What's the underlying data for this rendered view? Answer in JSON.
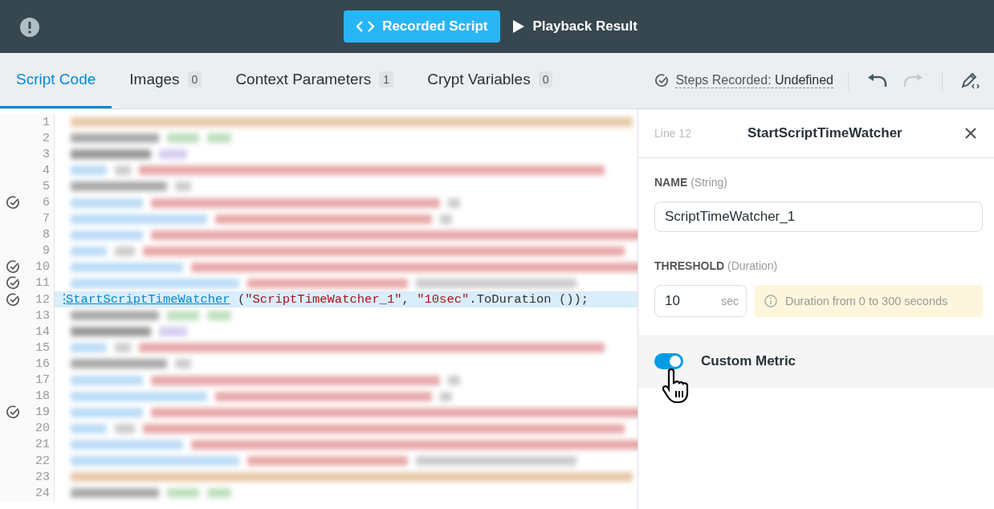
{
  "top_bar": {
    "modes": [
      {
        "label": "Recorded Script",
        "selected": true
      },
      {
        "label": "Playback Result",
        "selected": false
      }
    ]
  },
  "tabs": [
    {
      "label": "Script Code",
      "selected": true
    },
    {
      "label": "Images",
      "count": "0",
      "selected": false
    },
    {
      "label": "Context Parameters",
      "count": "1",
      "selected": false
    },
    {
      "label": "Crypt Variables",
      "count": "0",
      "selected": false
    }
  ],
  "steps_recorded": {
    "label": "Steps Recorded:",
    "value": "Undefined"
  },
  "toolbar": [
    {
      "kind": "undo",
      "disabled": false
    },
    {
      "kind": "redo",
      "disabled": true
    },
    {
      "kind": "edit",
      "disabled": false
    }
  ],
  "editor": {
    "lines": [
      {
        "number": "1",
        "checked": false,
        "selected": false,
        "kind": "blurred"
      },
      {
        "number": "2",
        "checked": false,
        "selected": false,
        "kind": "blurred"
      },
      {
        "number": "3",
        "checked": false,
        "selected": false,
        "kind": "blurred"
      },
      {
        "number": "4",
        "checked": false,
        "selected": false,
        "kind": "blurred"
      },
      {
        "number": "5",
        "checked": false,
        "selected": false,
        "kind": "blurred"
      },
      {
        "number": "6",
        "checked": true,
        "selected": false,
        "kind": "blurred"
      },
      {
        "number": "7",
        "checked": false,
        "selected": false,
        "kind": "blurred"
      },
      {
        "number": "8",
        "checked": false,
        "selected": false,
        "kind": "blurred"
      },
      {
        "number": "9",
        "checked": false,
        "selected": false,
        "kind": "blurred"
      },
      {
        "number": "10",
        "checked": true,
        "selected": false,
        "kind": "blurred"
      },
      {
        "number": "11",
        "checked": true,
        "selected": false,
        "kind": "blurred"
      },
      {
        "number": "12",
        "checked": true,
        "selected": true,
        "kind": "code",
        "marker": "⋮",
        "function": "StartScriptTimeWatcher",
        "open": " (",
        "args": [
          "\"ScriptTimeWatcher_1\"",
          "\"10sec\""
        ],
        "separator": ", ",
        "tail": ".ToDuration ());"
      },
      {
        "number": "13",
        "checked": false,
        "selected": false,
        "kind": "blurred"
      },
      {
        "number": "14",
        "checked": false,
        "selected": false,
        "kind": "blurred"
      },
      {
        "number": "15",
        "checked": false,
        "selected": false,
        "kind": "blurred"
      },
      {
        "number": "16",
        "checked": false,
        "selected": false,
        "kind": "blurred"
      },
      {
        "number": "17",
        "checked": false,
        "selected": false,
        "kind": "blurred"
      },
      {
        "number": "18",
        "checked": false,
        "selected": false,
        "kind": "blurred"
      },
      {
        "number": "19",
        "checked": true,
        "selected": false,
        "kind": "blurred"
      },
      {
        "number": "20",
        "checked": false,
        "selected": false,
        "kind": "blurred"
      },
      {
        "number": "21",
        "checked": false,
        "selected": false,
        "kind": "blurred"
      },
      {
        "number": "22",
        "checked": false,
        "selected": false,
        "kind": "blurred"
      },
      {
        "number": "23",
        "checked": false,
        "selected": false,
        "kind": "blurred"
      },
      {
        "number": "24",
        "checked": false,
        "selected": false,
        "kind": "blurred"
      }
    ]
  },
  "panel": {
    "line": "Line 12",
    "title": "StartScriptTimeWatcher",
    "name_field": {
      "label": "NAME",
      "type": "(String)",
      "value": "ScriptTimeWatcher_1"
    },
    "threshold_field": {
      "label": "THRESHOLD",
      "type": "(Duration)",
      "value": "10",
      "unit": "sec",
      "hint": "Duration from 0 to 300 seconds"
    },
    "custom_metric": {
      "label": "Custom Metric",
      "on": true
    }
  }
}
